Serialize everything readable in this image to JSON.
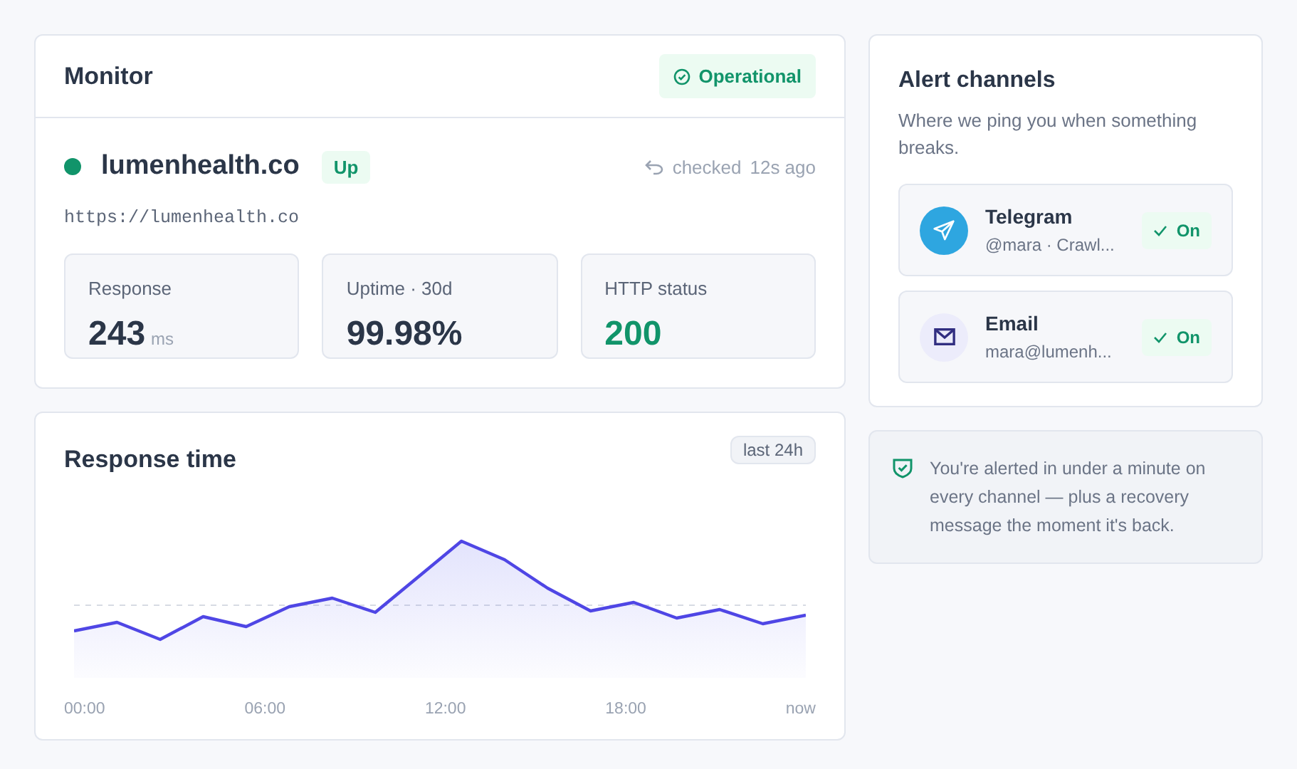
{
  "monitor": {
    "title": "Monitor",
    "status_badge": "Operational",
    "site": {
      "name": "lumenhealth.co",
      "state": "Up",
      "checked_label": "checked",
      "checked_ago": "12s ago",
      "url": "https://lumenhealth.co"
    },
    "stats": [
      {
        "label": "Response",
        "value": "243",
        "unit": "ms",
        "kind": "neutral"
      },
      {
        "label": "Uptime · 30d",
        "value": "99.98%",
        "kind": "neutral"
      },
      {
        "label": "HTTP status",
        "value": "200",
        "kind": "good"
      }
    ]
  },
  "response_time": {
    "title": "Response time",
    "range": "last 24h",
    "x_labels": [
      "00:00",
      "06:00",
      "12:00",
      "18:00",
      "now"
    ]
  },
  "alert_channels": {
    "title": "Alert channels",
    "subtitle": "Where we ping you when something breaks.",
    "channels": [
      {
        "kind": "telegram",
        "name": "Telegram",
        "detail": "@mara · Crawl...",
        "status": "On",
        "on": true
      },
      {
        "kind": "email",
        "name": "Email",
        "detail": "mara@lumenh...",
        "status": "On",
        "on": true
      }
    ]
  },
  "notice": "You're alerted in under a minute on every channel — plus a recovery message the moment it's back."
}
